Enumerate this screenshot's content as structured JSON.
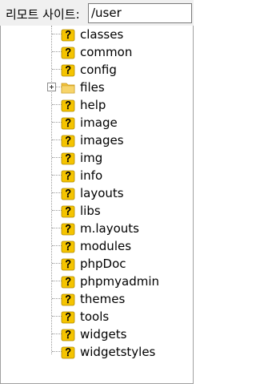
{
  "header": {
    "site_label": "리모트 사이트:",
    "path_value": "/user"
  },
  "tree": {
    "items": [
      {
        "label": "classes",
        "icon": "unknown-folder-icon"
      },
      {
        "label": "common",
        "icon": "unknown-folder-icon"
      },
      {
        "label": "config",
        "icon": "unknown-folder-icon"
      },
      {
        "label": "files",
        "icon": "folder-icon",
        "expandable": true
      },
      {
        "label": "help",
        "icon": "unknown-folder-icon"
      },
      {
        "label": "image",
        "icon": "unknown-folder-icon"
      },
      {
        "label": "images",
        "icon": "unknown-folder-icon"
      },
      {
        "label": "img",
        "icon": "unknown-folder-icon"
      },
      {
        "label": "info",
        "icon": "unknown-folder-icon"
      },
      {
        "label": "layouts",
        "icon": "unknown-folder-icon"
      },
      {
        "label": "libs",
        "icon": "unknown-folder-icon"
      },
      {
        "label": "m.layouts",
        "icon": "unknown-folder-icon"
      },
      {
        "label": "modules",
        "icon": "unknown-folder-icon"
      },
      {
        "label": "phpDoc",
        "icon": "unknown-folder-icon"
      },
      {
        "label": "phpmyadmin",
        "icon": "unknown-folder-icon"
      },
      {
        "label": "themes",
        "icon": "unknown-folder-icon"
      },
      {
        "label": "tools",
        "icon": "unknown-folder-icon"
      },
      {
        "label": "widgets",
        "icon": "unknown-folder-icon"
      },
      {
        "label": "widgetstyles",
        "icon": "unknown-folder-icon"
      }
    ]
  },
  "colors": {
    "question_mark": "#000000",
    "question_bg": "#f5c400",
    "folder": "#f2c13a"
  }
}
